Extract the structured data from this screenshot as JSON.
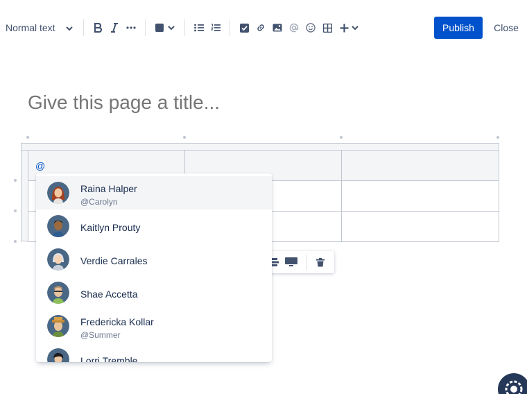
{
  "toolbar": {
    "text_style": "Normal text",
    "publish_label": "Publish",
    "close_label": "Close",
    "buttons": [
      "bold-icon",
      "italic-icon",
      "more-formatting-icon",
      "text-color-icon",
      "chevron-down-icon",
      "bullet-list-icon",
      "numbered-list-icon",
      "action-item-icon",
      "link-icon",
      "image-icon",
      "mention-icon",
      "emoji-icon",
      "table-icon",
      "insert-plus-icon"
    ]
  },
  "title": {
    "placeholder": "Give this page a title..."
  },
  "table": {
    "typed_text": "@"
  },
  "table_toolbar": {
    "buttons": [
      "table-layout-icon",
      "full-width-icon",
      "delete-icon"
    ]
  },
  "mentions": [
    {
      "name": "Raina Halper",
      "handle": "@Carolyn",
      "selected": true
    },
    {
      "name": "Kaitlyn Prouty",
      "handle": ""
    },
    {
      "name": "Verdie Carrales",
      "handle": ""
    },
    {
      "name": "Shae Accetta",
      "handle": ""
    },
    {
      "name": "Fredericka Kollar",
      "handle": "@Summer"
    },
    {
      "name": "Lorri Tremble",
      "handle": ""
    }
  ],
  "colors": {
    "primary": "#0052cc",
    "text": "#172b4d",
    "placeholder": "#97a0af",
    "selected_row": "#f4f5f7"
  }
}
